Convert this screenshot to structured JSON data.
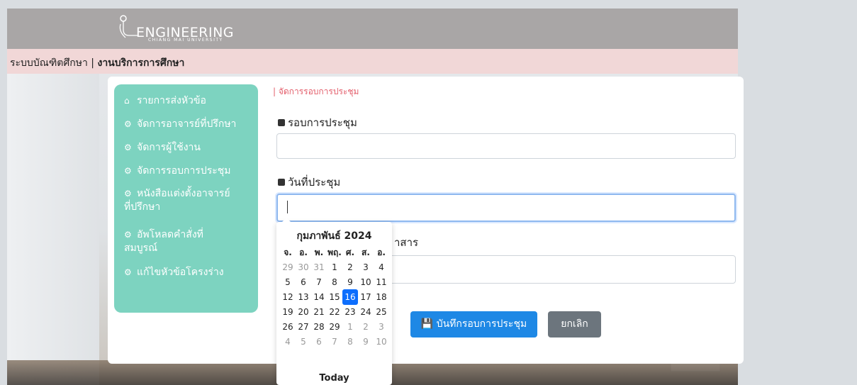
{
  "header": {
    "logo_title": "ENGINEERING",
    "logo_subtitle": "CHIANG MAI UNIVERSITY"
  },
  "subheader": {
    "system": "ระบบบัณฑิตศึกษา",
    "separator": " | ",
    "department": "งานบริการการศึกษา"
  },
  "sidebar": {
    "items": [
      {
        "icon": "home-icon",
        "label": "รายการส่งหัวข้อ"
      },
      {
        "icon": "gear-icon",
        "label": "จัดการอาจารย์ที่ปรึกษา"
      },
      {
        "icon": "gear-icon",
        "label": "จัดการผู้ใช้งาน"
      },
      {
        "icon": "gear-icon",
        "label": "จัดการรอบการประชุม"
      },
      {
        "icon": "gear-icon",
        "label": "หนังสือแต่งตั้งอาจารย์",
        "label2": "ที่ปรึกษา"
      },
      {
        "icon": "gear-icon",
        "label": "อัพโหลดคำสั่งที่",
        "label2": "สมบูรณ์"
      },
      {
        "icon": "gear-icon",
        "label": "แก้ไขหัวข้อโครงร่าง"
      }
    ]
  },
  "main": {
    "breadcrumb": "| จัดการรอบการประชุม",
    "field1_label": "รอบการประชุม",
    "field1_value": "",
    "field2_label": "วันที่ประชุม",
    "field2_value": "",
    "field3_label_visible": "าสาร",
    "field3_value": "",
    "save_button": "บันทึกรอบการประชุม",
    "cancel_button": "ยกเลิก"
  },
  "datepicker": {
    "title": "กุมภาพันธ์ 2024",
    "weekdays": [
      "จ.",
      "อ.",
      "พ.",
      "พฤ.",
      "ศ.",
      "ส.",
      "อ."
    ],
    "weeks": [
      [
        [
          "29",
          1
        ],
        [
          "30",
          1
        ],
        [
          "31",
          1
        ],
        [
          "1",
          0
        ],
        [
          "2",
          0
        ],
        [
          "3",
          0
        ],
        [
          "4",
          0
        ]
      ],
      [
        [
          "5",
          0
        ],
        [
          "6",
          0
        ],
        [
          "7",
          0
        ],
        [
          "8",
          0
        ],
        [
          "9",
          0
        ],
        [
          "10",
          0
        ],
        [
          "11",
          0
        ]
      ],
      [
        [
          "12",
          0
        ],
        [
          "13",
          0
        ],
        [
          "14",
          0
        ],
        [
          "15",
          0
        ],
        [
          "16",
          2
        ],
        [
          "17",
          0
        ],
        [
          "18",
          0
        ]
      ],
      [
        [
          "19",
          0
        ],
        [
          "20",
          0
        ],
        [
          "21",
          0
        ],
        [
          "22",
          0
        ],
        [
          "23",
          0
        ],
        [
          "24",
          0
        ],
        [
          "25",
          0
        ]
      ],
      [
        [
          "26",
          0
        ],
        [
          "27",
          0
        ],
        [
          "28",
          0
        ],
        [
          "29",
          0
        ],
        [
          "1",
          1
        ],
        [
          "2",
          1
        ],
        [
          "3",
          1
        ]
      ],
      [
        [
          "4",
          1
        ],
        [
          "5",
          1
        ],
        [
          "6",
          1
        ],
        [
          "7",
          1
        ],
        [
          "8",
          1
        ],
        [
          "9",
          1
        ],
        [
          "10",
          1
        ]
      ]
    ],
    "selected_day": "16",
    "today_label": "Today"
  },
  "colors": {
    "header_bg": "#a9a6a6",
    "subheader_bg": "#f1d7d7",
    "sidebar_bg": "#7dd3c0",
    "breadcrumb": "#e35d6a",
    "primary_button": "#1e88e5",
    "secondary_button": "#6c757d",
    "selected_day": "#0d6efd"
  }
}
